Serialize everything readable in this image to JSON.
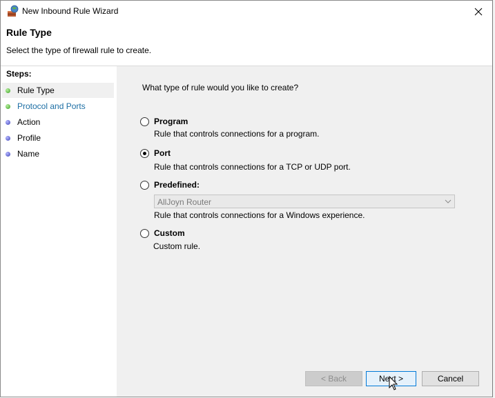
{
  "window": {
    "title": "New Inbound Rule Wizard",
    "icon": "firewall-wizard-icon",
    "close_icon": "close-icon"
  },
  "header": {
    "title": "Rule Type",
    "description": "Select the type of firewall rule to create."
  },
  "steps": {
    "title": "Steps:",
    "items": [
      {
        "label": "Rule Type",
        "status": "green",
        "active": true
      },
      {
        "label": "Protocol and Ports",
        "status": "green",
        "link": true
      },
      {
        "label": "Action",
        "status": "blue"
      },
      {
        "label": "Profile",
        "status": "blue"
      },
      {
        "label": "Name",
        "status": "blue"
      }
    ]
  },
  "main": {
    "question": "What type of rule would you like to create?",
    "options": [
      {
        "label": "Program",
        "description": "Rule that controls connections for a program.",
        "checked": false
      },
      {
        "label": "Port",
        "description": "Rule that controls connections for a TCP or UDP port.",
        "checked": true
      },
      {
        "label": "Predefined:",
        "description": "Rule that controls connections for a Windows experience.",
        "checked": false
      },
      {
        "label": "Custom",
        "description": "Custom rule.",
        "checked": false
      }
    ],
    "predefined_select": {
      "value": "AllJoyn Router",
      "disabled": true
    }
  },
  "buttons": {
    "back": "< Back",
    "next": "Next >",
    "cancel": "Cancel"
  },
  "colors": {
    "link": "#1c6ea4",
    "accent": "#0078d7"
  }
}
